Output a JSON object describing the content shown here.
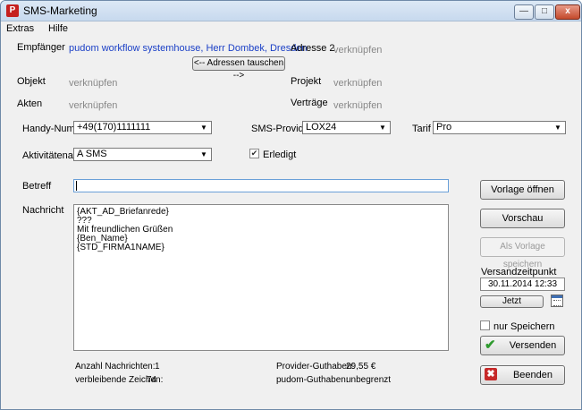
{
  "window": {
    "title": "SMS-Marketing",
    "icon_letter": "P"
  },
  "titlebar_buttons": {
    "minimize": "—",
    "maximize": "□",
    "close": "x"
  },
  "menu": {
    "items": [
      "Extras",
      "Hilfe"
    ]
  },
  "form": {
    "empfaenger_label": "Empfänger",
    "empfaenger_value": "pudom workflow systemhouse, Herr Dombek, Dresden",
    "adresse2_label": "Adresse 2",
    "adresse2_value": "verknüpfen",
    "swap_button": "<-- Adressen tauschen -->",
    "objekt_label": "Objekt",
    "objekt_value": "verknüpfen",
    "projekt_label": "Projekt",
    "projekt_value": "verknüpfen",
    "akten_label": "Akten",
    "akten_value": "verknüpfen",
    "vertraege_label": "Verträge",
    "vertraege_value": "verknüpfen",
    "handy_label": "Handy-Nummer",
    "handy_value": "+49(170)1111111",
    "provider_label": "SMS-Provider",
    "provider_value": "LOX24",
    "tarif_label": "Tarif",
    "tarif_value": "Pro",
    "aktivitaet_label": "Aktivitätenart",
    "aktivitaet_value": "A SMS",
    "erledigt_label": "Erledigt",
    "erledigt_checked": true,
    "betreff_label": "Betreff",
    "betreff_value": "",
    "nachricht_label": "Nachricht",
    "nachricht_lines": [
      "{AKT_AD_Briefanrede}",
      "",
      "???",
      "",
      "Mit freundlichen Grüßen",
      "{Ben_Name}",
      "{STD_FIRMA1NAME}"
    ]
  },
  "stats": {
    "anzahl_label": "Anzahl Nachrichten:",
    "anzahl_value": "1",
    "zeichen_label": "verbleibende Zeichen:",
    "zeichen_value": "74",
    "provider_guthaben_label": "Provider-Guthaben:",
    "provider_guthaben_value": "29,55 €",
    "pudom_guthaben_label": "pudom-Guthaben:",
    "pudom_guthaben_value": "unbegrenzt"
  },
  "sidebar": {
    "vorlage_oeffnen": "Vorlage öffnen",
    "vorschau": "Vorschau",
    "als_vorlage": "Als Vorlage speichern",
    "versandzeit_label": "Versandzeitpunkt",
    "versandzeit_value": "30.11.2014 12:33",
    "jetzt": "Jetzt",
    "nur_speichern": "nur Speichern",
    "versenden": "Versenden",
    "beenden": "Beenden"
  },
  "icons": {
    "app": "app-logo-icon",
    "calendar": "calendar-icon",
    "send": "checkmark-icon",
    "exit": "close-x-icon"
  }
}
